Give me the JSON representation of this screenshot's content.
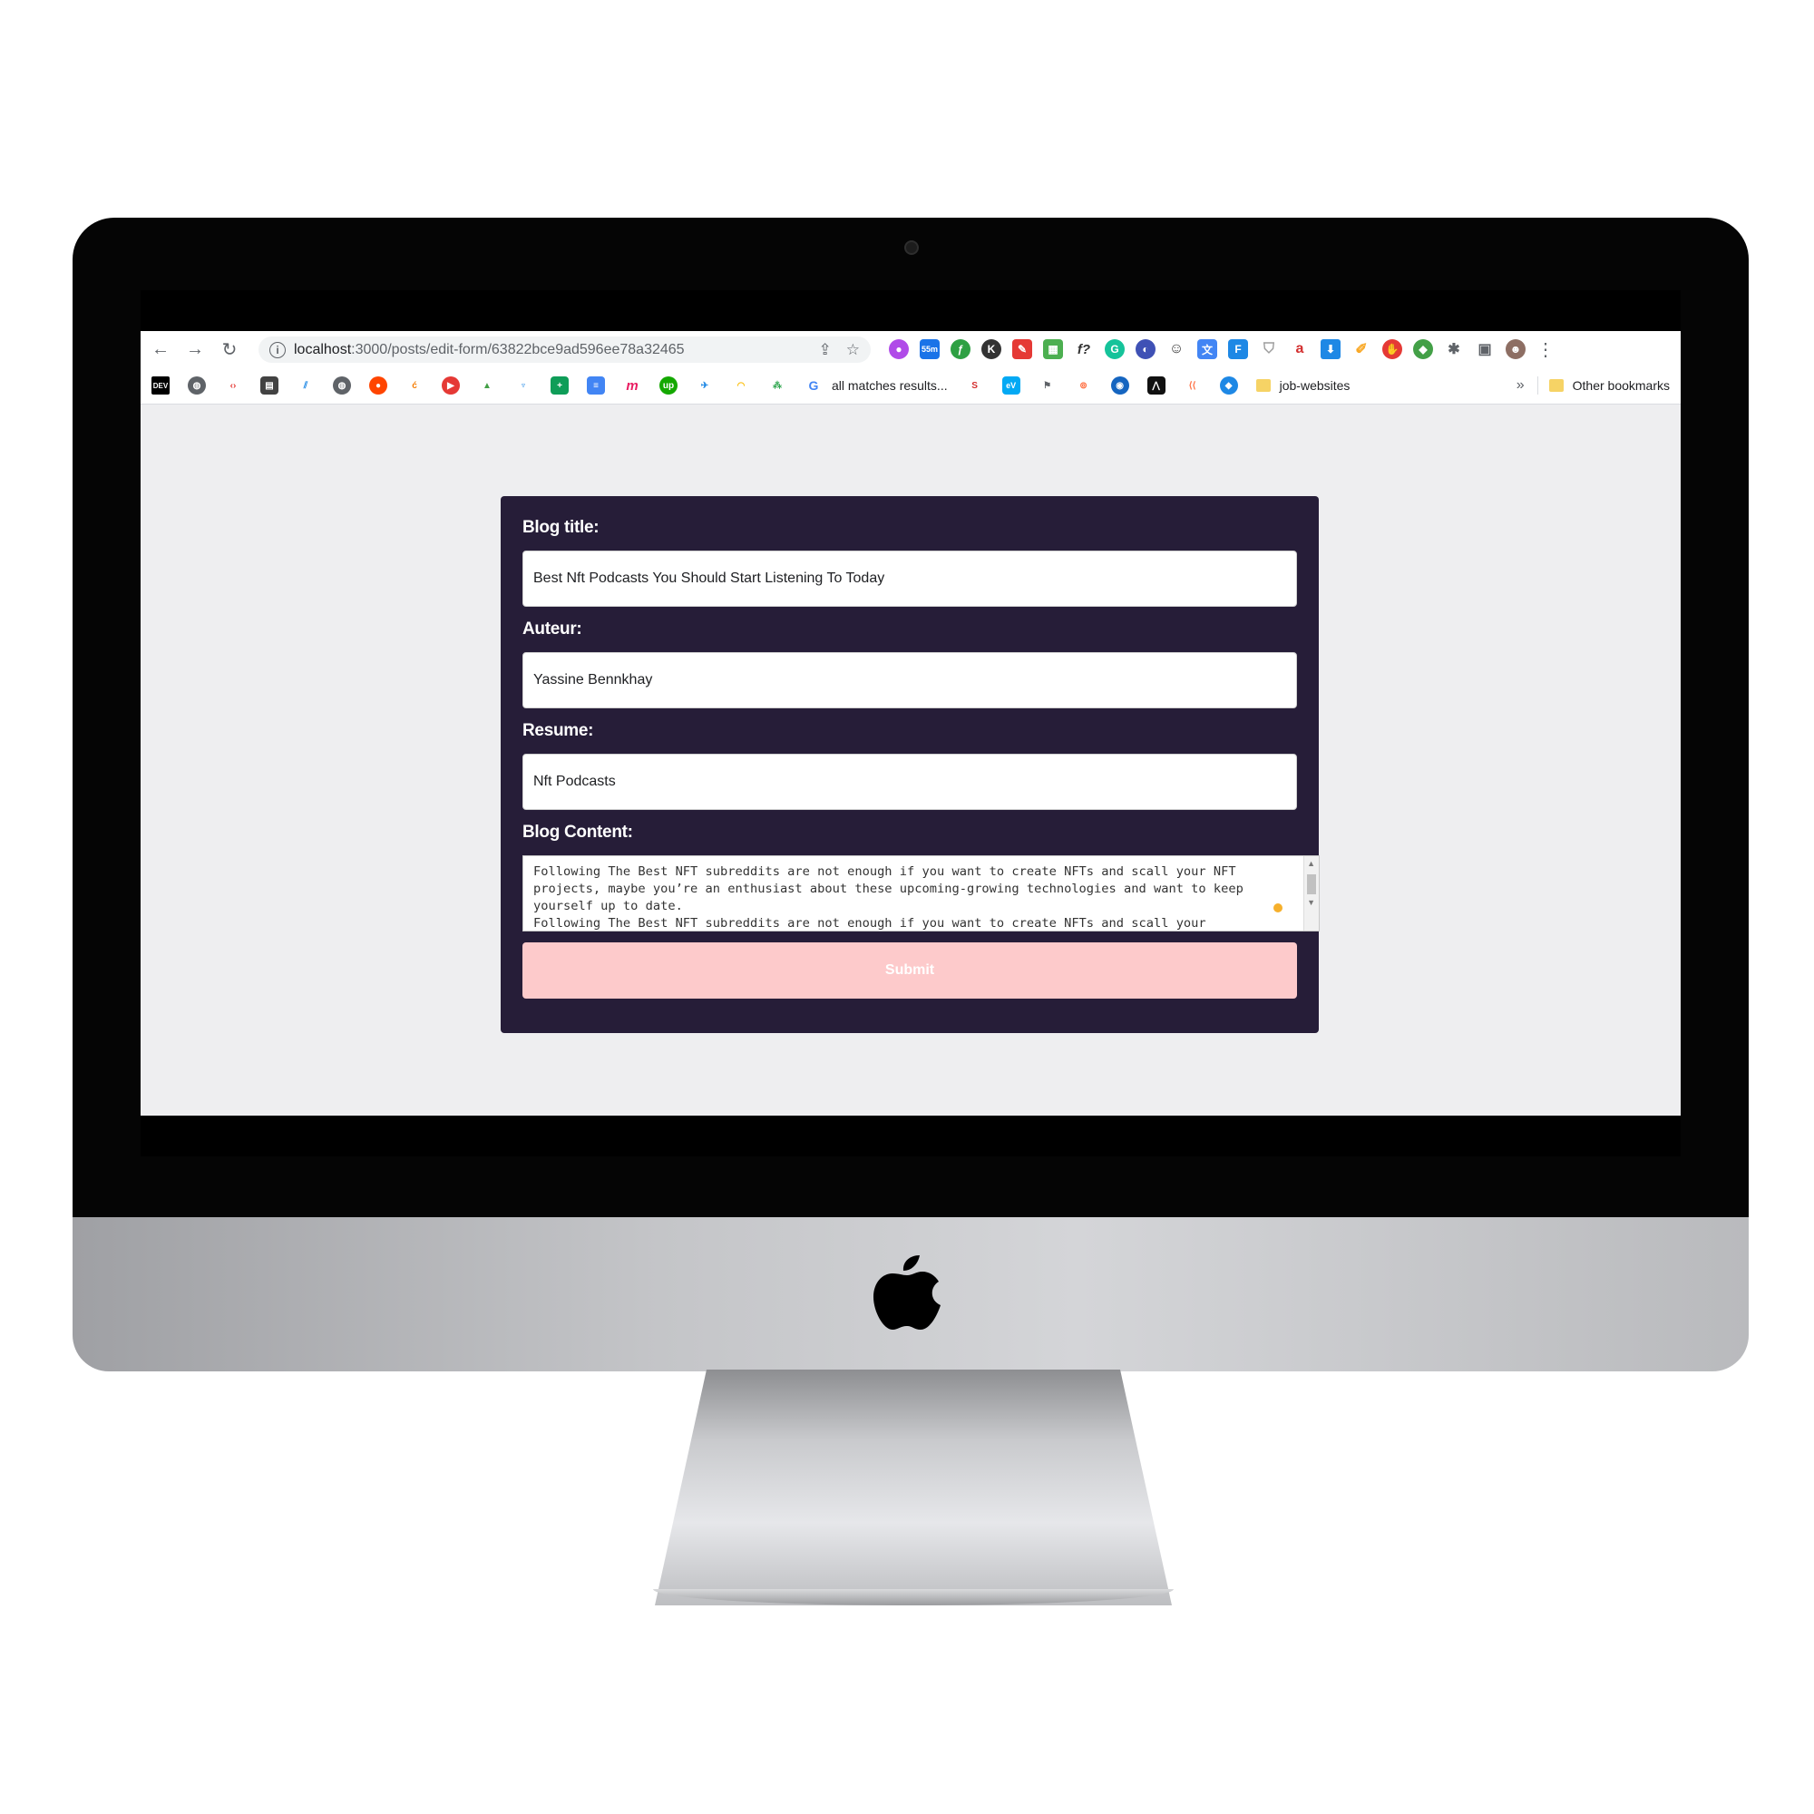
{
  "browser": {
    "url_host": "localhost",
    "url_path": ":3000/posts/edit-form/63822bce9ad596ee78a32465",
    "extension_badges": [
      "55m",
      "f?",
      "a"
    ],
    "bookmarks": {
      "dev_label": "DEV",
      "text_item": "all matches results...",
      "folder_label": "job-websites",
      "other_label": "Other bookmarks"
    }
  },
  "form": {
    "title_label": "Blog title:",
    "title_value": "Best Nft Podcasts You Should Start Listening To Today",
    "author_label": "Auteur:",
    "author_value": "Yassine Bennkhay",
    "resume_label": "Resume:",
    "resume_value": "Nft Podcasts",
    "content_label": "Blog Content:",
    "content_value": "Following The Best NFT subreddits are not enough if you want to create NFTs and scall your NFT projects, maybe you’re an enthusiast about these upcoming-growing technologies and want to keep yourself up to date.\nFollowing The Best NFT subreddits are not enough if you want to create NFTs and scall your",
    "submit_label": "Submit"
  },
  "colors": {
    "card_background": "#261d38",
    "submit_background": "#fdcacb",
    "page_background": "#eeeef0"
  }
}
